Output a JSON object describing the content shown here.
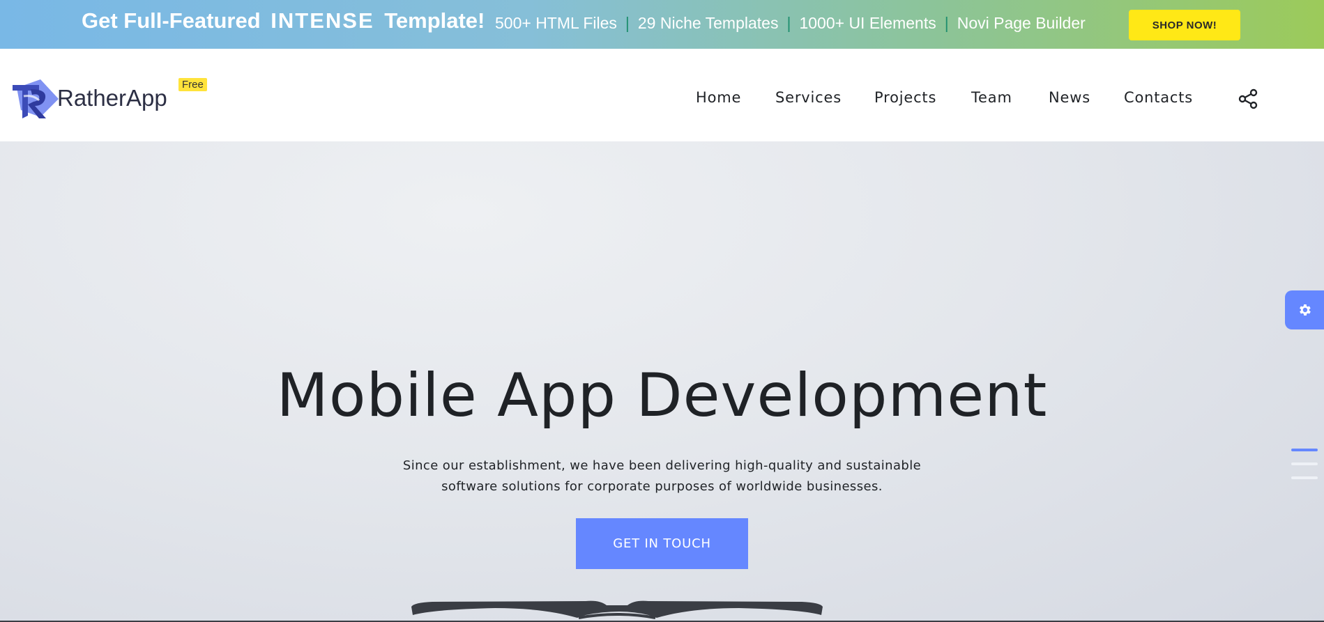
{
  "promo": {
    "title_prefix": "Get Full-Featured",
    "title_brand": "INTENSE",
    "title_suffix": "Template!",
    "features": [
      "500+ HTML Files",
      "29 Niche Templates",
      "1000+ UI Elements",
      "Novi Page Builder"
    ],
    "separator": "|",
    "shop_button": "SHOP NOW!"
  },
  "header": {
    "logo_text": "RatherApp",
    "badge": "Free",
    "nav": [
      "Home",
      "Services",
      "Projects",
      "Team",
      "News",
      "Contacts"
    ],
    "share_icon": "share-icon"
  },
  "hero": {
    "title": "Mobile App Development",
    "subtitle_line1": "Since our establishment, we have been delivering high-quality and sustainable",
    "subtitle_line2": "software solutions for corporate purposes of worldwide businesses.",
    "cta": "GET IN TOUCH"
  },
  "side": {
    "settings_icon": "gear-icon",
    "active_slide": 1,
    "slide_count": 3
  },
  "colors": {
    "accent": "#6587ff",
    "shop_button": "#ffe816",
    "badge": "#ffe33b",
    "text": "#1f2226"
  }
}
